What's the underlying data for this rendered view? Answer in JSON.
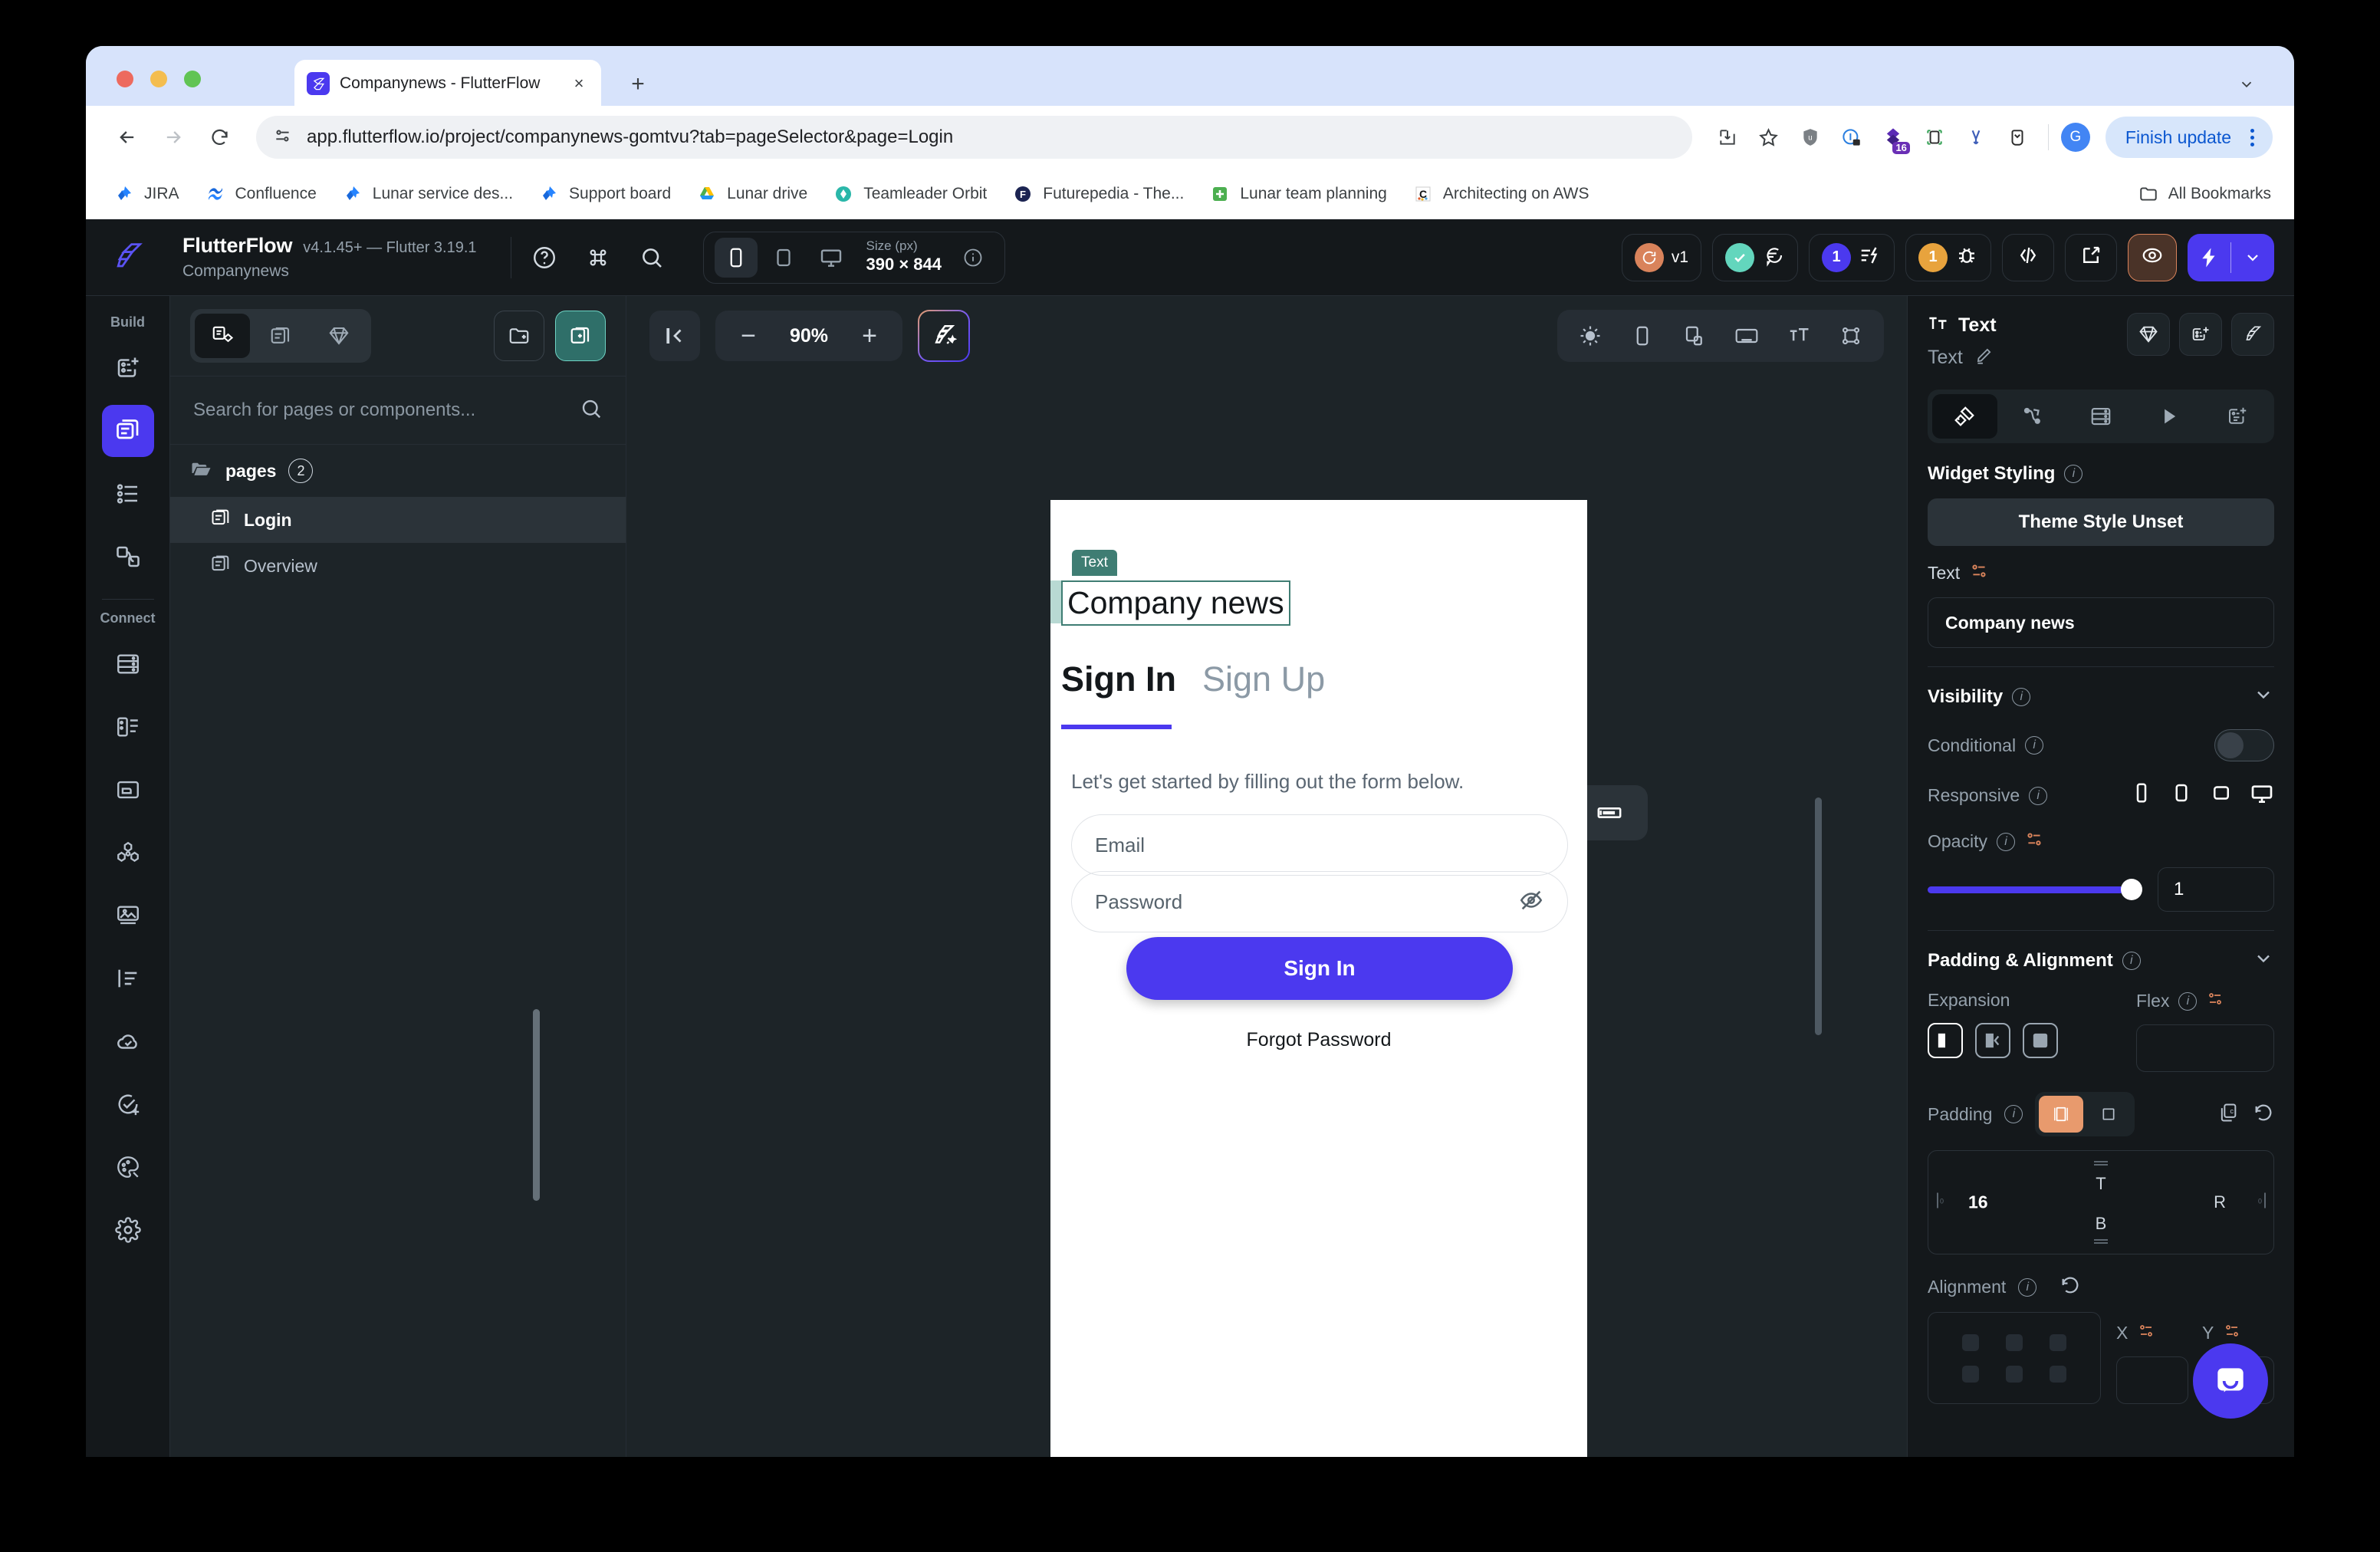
{
  "browser": {
    "tab": {
      "title": "Companynews - FlutterFlow",
      "favicon": "flutterflow-icon",
      "close": "×"
    },
    "new_tab": "+",
    "tabstrip_caret": "chevron-down-icon",
    "nav": {
      "back": "back-arrow-icon",
      "forward": "forward-arrow-icon",
      "reload": "reload-icon"
    },
    "omnibox": {
      "site_info": "site-settings-icon",
      "url": "app.flutterflow.io/project/companynews-gomtvu?tab=pageSelector&page=Login"
    },
    "toolbar_icons": [
      "install-app-icon",
      "bookmark-star-icon",
      "ublock-shield-icon",
      "onepassword-icon",
      "extension-purple-icon",
      "screenshot-icon",
      "vimium-icon",
      "pocket-icon"
    ],
    "extension_badge": "16",
    "avatar_letter": "G",
    "finish_update": "Finish update",
    "kebab": "chrome-menu-icon",
    "bookmarks": [
      {
        "label": "JIRA",
        "icon": "jira-icon"
      },
      {
        "label": "Confluence",
        "icon": "confluence-icon"
      },
      {
        "label": "Lunar service des...",
        "icon": "jira-icon"
      },
      {
        "label": "Support board",
        "icon": "jira-icon"
      },
      {
        "label": "Lunar drive",
        "icon": "google-drive-icon"
      },
      {
        "label": "Teamleader Orbit",
        "icon": "teamleader-icon"
      },
      {
        "label": "Futurepedia - The...",
        "icon": "futurepedia-icon"
      },
      {
        "label": "Lunar team planning",
        "icon": "planning-icon"
      },
      {
        "label": "Architecting on AWS",
        "icon": "coursera-icon"
      }
    ],
    "all_bookmarks": {
      "label": "All Bookmarks",
      "icon": "folder-icon"
    }
  },
  "app_header": {
    "logo": "flutterflow-logo",
    "name": "FlutterFlow",
    "version": "v4.1.45+ — Flutter 3.19.1",
    "project": "Companynews",
    "icons": [
      "help-icon",
      "command-icon",
      "search-icon"
    ],
    "size_group": {
      "devices": [
        "phone-icon",
        "tablet-icon",
        "desktop-icon"
      ],
      "active_device": 0,
      "caption": "Size (px)",
      "value": "390 × 844",
      "info": "info-icon"
    },
    "right_pills": [
      {
        "name": "version-pill",
        "badge_text": "",
        "badge_color": "#d9835b",
        "icon": "history-icon",
        "label": "v1"
      },
      {
        "name": "tests-pill",
        "badge_color": "#63d6bd",
        "icon": "check-icon",
        "label": "",
        "second_icon": "comment-icon"
      },
      {
        "name": "issues-pill",
        "badge_color": "#4b39ef",
        "badge_text": "1",
        "icon": "lightning-list-icon"
      },
      {
        "name": "debug-pill",
        "badge_color": "#e8a33d",
        "badge_text": "1",
        "icon": "bug-icon"
      },
      {
        "name": "code-pill",
        "icon": "code-icon"
      },
      {
        "name": "open-pill",
        "icon": "open-external-icon"
      },
      {
        "name": "preview-pill",
        "icon": "eye-target-icon"
      }
    ],
    "launch": {
      "icon": "lightning-icon",
      "caret": "chevron-down-icon"
    }
  },
  "rail": {
    "build_caption": "Build",
    "build_items": [
      {
        "name": "widget-palette-icon"
      },
      {
        "name": "page-selector-icon",
        "active": true
      },
      {
        "name": "widget-tree-icon"
      },
      {
        "name": "navigation-icon"
      }
    ],
    "connect_caption": "Connect",
    "connect_items": [
      {
        "name": "database-icon"
      },
      {
        "name": "api-calls-icon"
      },
      {
        "name": "storage-icon"
      },
      {
        "name": "integrations-icon"
      },
      {
        "name": "media-assets-icon"
      },
      {
        "name": "local-state-icon"
      },
      {
        "name": "deploy-cloud-icon"
      },
      {
        "name": "tests-icon"
      },
      {
        "name": "theme-icon"
      },
      {
        "name": "settings-icon"
      }
    ]
  },
  "pages_panel": {
    "segments": [
      {
        "name": "pages-components-icon",
        "active": true
      },
      {
        "name": "pages-only-icon"
      },
      {
        "name": "components-icon"
      }
    ],
    "new_folder": "new-folder-icon",
    "new_page": "new-page-icon",
    "search_placeholder": "Search for pages or components...",
    "search_value": "",
    "search_icon": "search-icon",
    "folder": {
      "name": "pages",
      "count": "2",
      "icon": "folder-open-icon"
    },
    "items": [
      {
        "label": "Login",
        "selected": true,
        "icon": "page-icon"
      },
      {
        "label": "Overview",
        "selected": false,
        "icon": "page-icon"
      }
    ]
  },
  "canvas": {
    "collapse_icon": "collapse-left-icon",
    "zoom_out": "−",
    "zoom_level": "90%",
    "zoom_in": "+",
    "magic_icon": "ai-design-icon",
    "view_icons": [
      "brightness-icon",
      "device-frame-icon",
      "split-view-icon",
      "keyboard-icon",
      "text-size-icon",
      "layout-guides-icon"
    ],
    "float_button": "text-field-icon"
  },
  "preview": {
    "selected_widget_tag": "Text",
    "title": "Company news",
    "tab_signin": "Sign In",
    "tab_signup": "Sign Up",
    "subtitle": "Let's get started by filling out the form below.",
    "email_placeholder": "Email",
    "password_placeholder": "Password",
    "password_eye_icon": "eye-off-icon",
    "signin_button": "Sign In",
    "forgot_password": "Forgot Password"
  },
  "properties": {
    "type_icon": "text-widget-icon",
    "type_label": "Text",
    "widget_name": "Text",
    "rename_icon": "pencil-icon",
    "head_actions": [
      "component-icon",
      "add-widget-icon",
      "flutterflow-icon"
    ],
    "tabs": [
      {
        "name": "properties-tab",
        "icon": "ruler-pencil-icon",
        "active": true
      },
      {
        "name": "actions-tab",
        "icon": "actions-flow-icon"
      },
      {
        "name": "backend-tab",
        "icon": "database-icon"
      },
      {
        "name": "animations-tab",
        "icon": "play-icon"
      },
      {
        "name": "generate-tab",
        "icon": "add-doc-icon"
      }
    ],
    "widget_styling": {
      "title": "Widget Styling",
      "info": "info-icon",
      "theme_button": "Theme Style Unset"
    },
    "text_section": {
      "label": "Text",
      "var_icon": "variable-icon",
      "value": "Company news"
    },
    "visibility": {
      "title": "Visibility",
      "info": "info-icon",
      "chevron": "chevron-down-icon",
      "conditional_label": "Conditional",
      "conditional_on": false,
      "responsive_label": "Responsive",
      "responsive_devices": [
        "phone-icon",
        "tablet-small-icon",
        "tablet-large-icon",
        "desktop-icon"
      ],
      "opacity_label": "Opacity",
      "opacity_value": "1",
      "opacity_pct": 100
    },
    "padding_alignment": {
      "title": "Padding & Alignment",
      "info": "info-icon",
      "chevron": "chevron-down-icon",
      "expansion_label": "Expansion",
      "flex_label": "Flex",
      "flex_value": "",
      "padding_label": "Padding",
      "padding_top": "T",
      "padding_bottom": "B",
      "padding_left": "16",
      "padding_right": "R",
      "padding_left_unit": "0",
      "padding_right_unit": "0",
      "copy_icon": "copy-icon",
      "reset_icon": "reset-icon",
      "alignment_label": "Alignment",
      "alignment_reset": "reset-icon",
      "x_label": "X",
      "y_label": "Y"
    },
    "intercom": "intercom-chat-icon"
  },
  "colors": {
    "accent": "#4b39ef",
    "teal": "#3f7d73",
    "orange": "#e89a6d",
    "panel_bg": "#14181b",
    "panel_alt": "#1d2428"
  }
}
